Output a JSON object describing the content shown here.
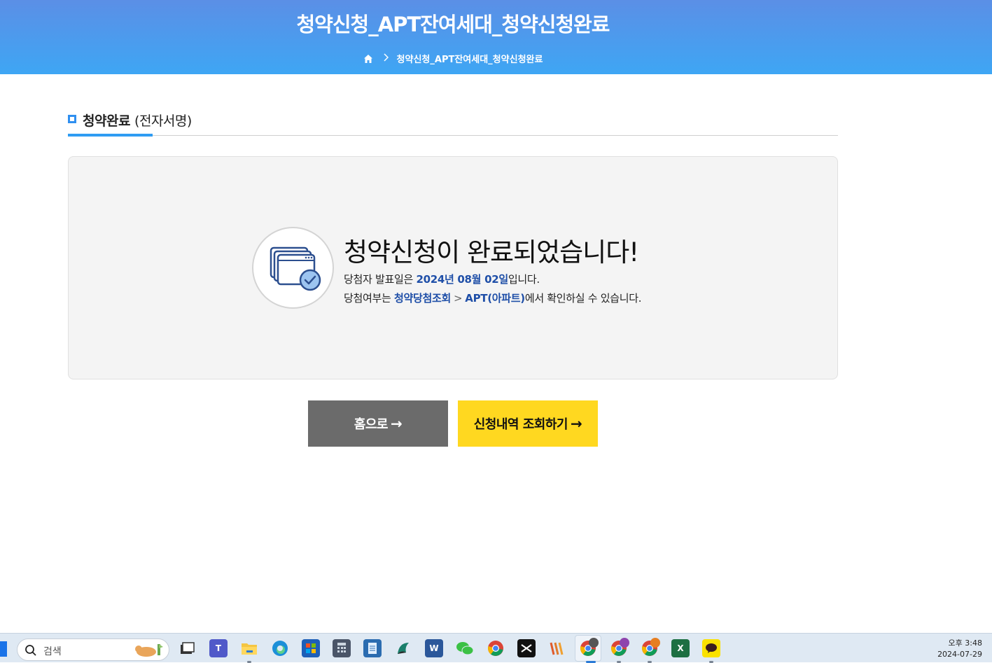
{
  "header": {
    "title": "청약신청_APT잔여세대_청약신청완료",
    "breadcrumb": "청약신청_APT잔여세대_청약신청완료"
  },
  "section": {
    "title_main": "청약완료",
    "title_sub": "(전자서명)"
  },
  "result": {
    "heading": "청약신청이 완료되었습니다!",
    "line1_prefix": "당첨자 발표일은 ",
    "line1_date": "2024년 08월 02일",
    "line1_suffix": "입니다.",
    "line2_prefix": "당첨여부는 ",
    "line2_link1": "청약당첨조회",
    "line2_sep": ">",
    "line2_link2": "APT(아파트)",
    "line2_suffix": "에서 확인하실 수 있습니다."
  },
  "buttons": {
    "home": "홈으로",
    "inquiry": "신청내역 조회하기",
    "arrow": "→"
  },
  "colors": {
    "header_top": "#5b8fe6",
    "header_bottom": "#3ea6f4",
    "accent_blue": "#2f9cf3",
    "highlight_text": "#1f4fa8",
    "home_button": "#6b6b6b",
    "inquiry_button": "#ffd820"
  },
  "taskbar": {
    "search_placeholder": "검색",
    "apps": [
      "task-view-icon",
      "teams-icon",
      "file-explorer-icon",
      "edge-icon",
      "store-icon",
      "calculator-icon",
      "notepad-icon",
      "app-icon",
      "word-icon",
      "wechat-icon",
      "chrome-icon",
      "capcut-icon",
      "app-icon",
      "chrome-icon",
      "chrome-icon",
      "chrome-icon",
      "excel-icon",
      "kakaotalk-icon"
    ],
    "time": "오후 3:48",
    "date": "2024-07-29"
  }
}
